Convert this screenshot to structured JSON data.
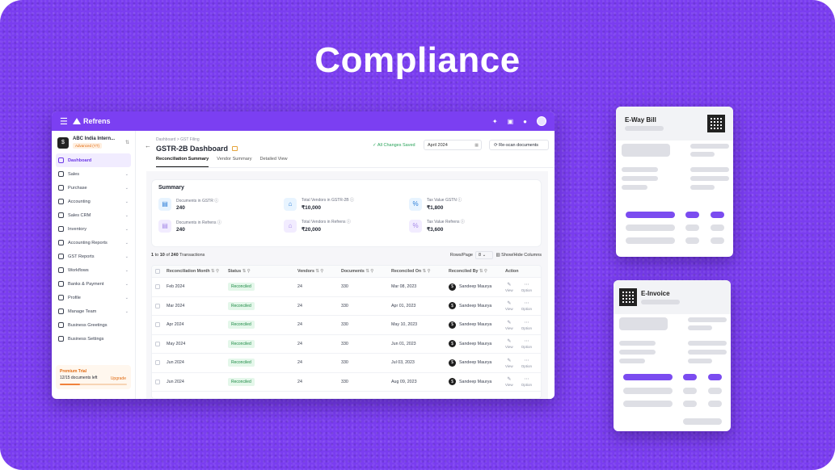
{
  "hero": {
    "title": "Compliance"
  },
  "app": {
    "brand": "Refrens",
    "org": {
      "name": "ABC India Intern...",
      "plan": "Advanced (YT)"
    },
    "sidebar": [
      {
        "label": "Dashboard",
        "active": true,
        "chevron": false
      },
      {
        "label": "Sales",
        "chevron": true
      },
      {
        "label": "Purchase",
        "chevron": true
      },
      {
        "label": "Accounting",
        "chevron": true
      },
      {
        "label": "Sales CRM",
        "chevron": true
      },
      {
        "label": "Inventory",
        "chevron": true
      },
      {
        "label": "Accounting Reports",
        "chevron": true
      },
      {
        "label": "GST Reports",
        "chevron": true
      },
      {
        "label": "Workflows",
        "chevron": true
      },
      {
        "label": "Banks & Payment",
        "chevron": true
      },
      {
        "label": "Profile",
        "chevron": true
      },
      {
        "label": "Manage Team",
        "chevron": true
      },
      {
        "label": "Business Greetings",
        "chevron": false
      },
      {
        "label": "Business Settings",
        "chevron": false
      }
    ],
    "trial": {
      "label": "Premium Trial",
      "docs": "12/15 documents left",
      "upgrade": "Upgrade"
    },
    "breadcrumb": "Dashboard  >  GST Filing",
    "page_title": "GSTR-2B Dashboard",
    "saved": "✓ All Changes Saved",
    "month": "April 2024",
    "rescan": "Re-scan documents",
    "tabs": [
      "Reconciliation Summary",
      "Vendor Summary",
      "Detailed View"
    ],
    "summary": {
      "heading": "Summary",
      "cards": [
        {
          "label": "Documents in GSTR",
          "value": "240",
          "icon": "document-icon"
        },
        {
          "label": "Total Vendors in GSTR-2B",
          "value": "₹10,000",
          "icon": "vendors-icon"
        },
        {
          "label": "Tax Value GSTN",
          "value": "₹1,800",
          "icon": "percent-icon"
        },
        {
          "label": "Documents in Refrens",
          "value": "240",
          "icon": "document-icon"
        },
        {
          "label": "Total Vendors in Refrens",
          "value": "₹20,000",
          "icon": "vendors-icon"
        },
        {
          "label": "Tax Value Refrens",
          "value": "₹3,600",
          "icon": "percent-icon"
        }
      ]
    },
    "list": {
      "from": "1",
      "to": "10",
      "total": "240",
      "suffix": "Transactions",
      "rows_label": "Rows/Page",
      "rows_value": "8",
      "toggle_columns": "Show/Hide Columns"
    },
    "table": {
      "headers": [
        "Reconciliation Month",
        "Status",
        "Vendors",
        "Documents",
        "Reconciled On",
        "Reconciled By",
        "Action"
      ],
      "rows": [
        {
          "month": "Feb 2024",
          "status": "Reconciled",
          "vendors": "24",
          "documents": "330",
          "on": "Mar 08, 2023",
          "by": "Sandeep Maurya"
        },
        {
          "month": "Mar 2024",
          "status": "Reconciled",
          "vendors": "24",
          "documents": "330",
          "on": "Apr 01, 2023",
          "by": "Sandeep Maurya"
        },
        {
          "month": "Apr 2024",
          "status": "Reconciled",
          "vendors": "24",
          "documents": "330",
          "on": "May 10, 2023",
          "by": "Sandeep Maurya"
        },
        {
          "month": "May 2024",
          "status": "Reconciled",
          "vendors": "24",
          "documents": "330",
          "on": "Jun 01, 2023",
          "by": "Sandeep Maurya"
        },
        {
          "month": "Jun 2024",
          "status": "Reconciled",
          "vendors": "24",
          "documents": "330",
          "on": "Jul 03, 2023",
          "by": "Sandeep Maurya"
        },
        {
          "month": "Jun 2024",
          "status": "Reconciled",
          "vendors": "24",
          "documents": "330",
          "on": "Aug 09, 2023",
          "by": "Sandeep Maurya"
        }
      ],
      "action_view": "View",
      "action_option": "Option"
    }
  },
  "eway": {
    "title": "E-Way Bill"
  },
  "einvoice": {
    "title": "E-Invoice"
  }
}
